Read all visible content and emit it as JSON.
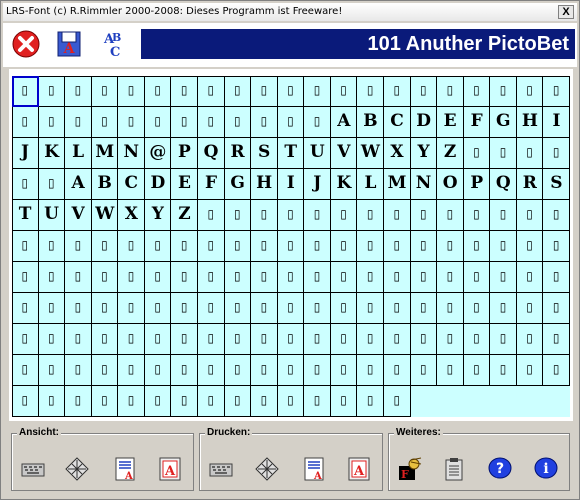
{
  "window": {
    "title": "LRS-Font (c) R.Rimmler 2000-2008:  Dieses Programm ist Freeware!",
    "close_glyph": "X"
  },
  "toolbar": {
    "banner": "101 Anuther PictoBet",
    "banner_color": "#0a1a7a"
  },
  "glyph_grid": {
    "columns": 21,
    "rows": 11,
    "placeholder": "▯",
    "selected_index": 0,
    "row_chars": [
      "▯▯▯▯▯▯▯▯▯▯▯▯▯▯▯▯▯▯▯▯▯",
      "▯▯▯▯▯▯▯▯▯▯▯▯ABCDEFGHI",
      "JKLMN@PQRSTUVWXYZ▯▯▯▯",
      "▯▯ABCDEFGHIJKLMNOPQRS",
      "TUVWXYZ▯▯▯▯▯▯▯▯▯▯▯▯▯▯",
      "▯▯▯▯▯▯▯▯▯▯▯▯▯▯▯▯▯▯▯▯▯",
      "▯▯▯▯▯▯▯▯▯▯▯▯▯▯▯▯▯▯▯▯▯",
      "▯▯▯▯▯▯▯▯▯▯▯▯▯▯▯▯▯▯▯▯▯",
      "▯▯▯▯▯▯▯▯▯▯▯▯▯▯▯▯▯▯▯▯▯",
      "▯▯▯▯▯▯▯▯▯▯▯▯▯▯▯▯▯▯▯▯▯",
      "▯▯▯▯▯▯▯▯▯▯▯▯▯▯▯"
    ],
    "background": "#ccffff"
  },
  "bottom": {
    "ansicht_label": "Ansicht:",
    "drucken_label": "Drucken:",
    "weiteres_label": "Weiteres:",
    "ansicht_icons": [
      "keyboard-icon",
      "character-map-icon",
      "document-icon",
      "font-preview-icon"
    ],
    "drucken_icons": [
      "keyboard-print-icon",
      "character-map-print-icon",
      "document-print-icon",
      "font-preview-print-icon"
    ],
    "weiteres_icons": [
      "install-font-icon",
      "clipboard-icon",
      "help-icon",
      "info-icon"
    ]
  }
}
